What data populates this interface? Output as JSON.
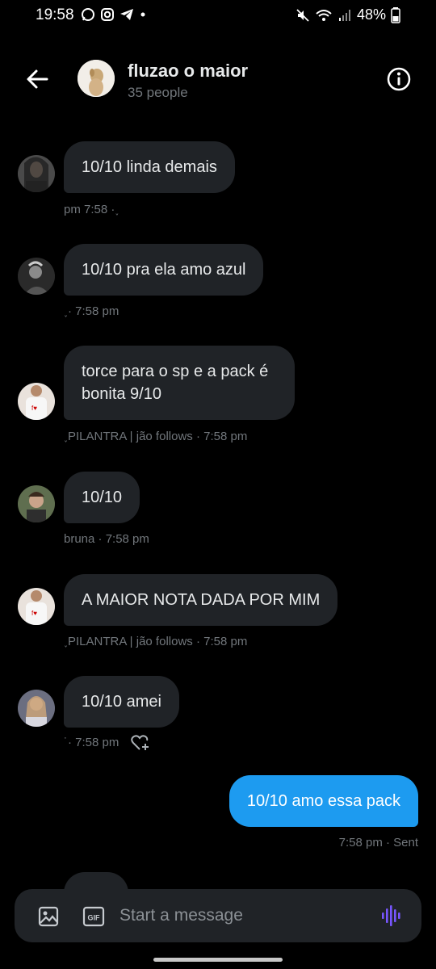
{
  "status_bar": {
    "time": "19:58",
    "app_icons": [
      "whatsapp-icon",
      "instagram-icon",
      "telegram-icon",
      "dot"
    ],
    "battery": "48%"
  },
  "header": {
    "title": "fluzao o maior",
    "subtitle": "35 people"
  },
  "messages": [
    {
      "text": "10/10 linda demais",
      "meta": "pm 7:58 ·˯"
    },
    {
      "text": "10/10 pra ela amo azul",
      "meta": "˯· 7:58 pm"
    },
    {
      "text": "torce para o sp e a pack é bonita 9/10",
      "meta": "˯PILANTRA | jão follows · 7:58 pm"
    },
    {
      "text": "10/10",
      "meta": "bruna · 7:58 pm"
    },
    {
      "text": "A MAIOR NOTA DADA POR MIM",
      "meta": "˯PILANTRA | jão follows · 7:58 pm"
    },
    {
      "text": "10/10 amei",
      "meta": "˙· 7:58 pm"
    }
  ],
  "outgoing": {
    "text": "10/10 amo essa pack",
    "meta": "7:58 pm · Sent"
  },
  "composer": {
    "placeholder": "Start a message",
    "gif_label": "GIF"
  },
  "colors": {
    "background": "#000000",
    "bubble_in": "#202327",
    "bubble_out": "#1d9bf0",
    "muted_text": "#71767b",
    "voice_accent": "#7856ff"
  }
}
